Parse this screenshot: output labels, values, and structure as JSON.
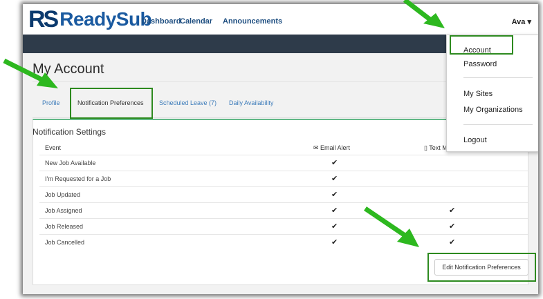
{
  "brand": {
    "logo_mark": "RS",
    "logo_name": "ReadySub"
  },
  "nav": {
    "links": [
      "Dashboard",
      "Calendar",
      "Announcements"
    ],
    "user": "Ava ▾"
  },
  "page": {
    "title": "My Account"
  },
  "tabs": [
    "Profile",
    "Notification Preferences",
    "Scheduled Leave (7)",
    "Daily Availability"
  ],
  "panel": {
    "title": "Notification Settings",
    "headers": {
      "event": "Event",
      "email": "✉ Email Alert",
      "text": "▯ Text Message Alert"
    },
    "rows": [
      {
        "event": "New Job Available",
        "email": "✔",
        "text": ""
      },
      {
        "event": "I'm Requested for a Job",
        "email": "✔",
        "text": ""
      },
      {
        "event": "Job Updated",
        "email": "✔",
        "text": ""
      },
      {
        "event": "Job Assigned",
        "email": "✔",
        "text": "✔"
      },
      {
        "event": "Job Released",
        "email": "✔",
        "text": "✔"
      },
      {
        "event": "Job Cancelled",
        "email": "✔",
        "text": "✔"
      }
    ],
    "edit_button": "Edit Notification Preferences"
  },
  "dropdown": {
    "items": [
      "Account",
      "Password",
      "My Sites",
      "My Organizations",
      "Logout"
    ]
  },
  "colors": {
    "annotation": "#2d8a1f",
    "brand": "#0b3a6e",
    "accent_line": "#62b887",
    "navbar_dark": "#2e3b4a"
  }
}
